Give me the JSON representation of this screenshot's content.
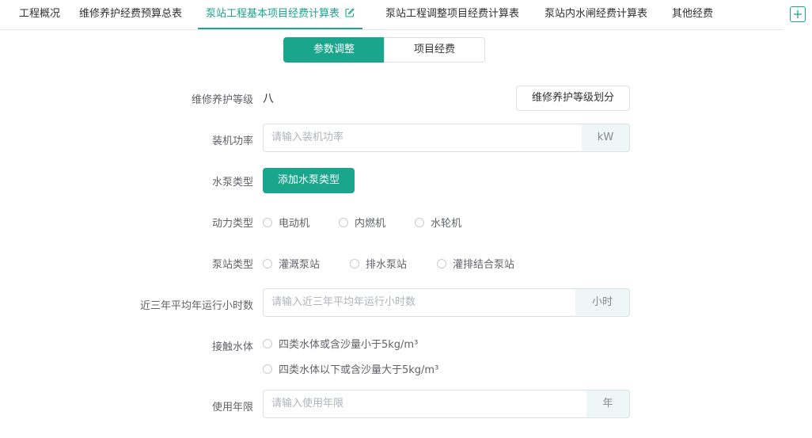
{
  "tabs": [
    {
      "label": "工程概况"
    },
    {
      "label": "维修养护经费预算总表"
    },
    {
      "label": "泵站工程基本项目经费计算表"
    },
    {
      "label": "泵站工程调整项目经费计算表"
    },
    {
      "label": "泵站内水闸经费计算表"
    },
    {
      "label": "其他经费"
    }
  ],
  "active_tab_index": 2,
  "segment": {
    "params_label": "参数调整",
    "funds_label": "项目经费"
  },
  "form": {
    "level": {
      "label": "维修养护等级",
      "value": "八",
      "button_label": "维修养护等级划分"
    },
    "power": {
      "label": "装机功率",
      "placeholder": "请输入装机功率",
      "unit": "kW"
    },
    "pump_type": {
      "label": "水泵类型",
      "button_label": "添加水泵类型"
    },
    "drive_type": {
      "label": "动力类型",
      "options": [
        "电动机",
        "内燃机",
        "水轮机"
      ]
    },
    "station_type": {
      "label": "泵站类型",
      "options": [
        "灌溉泵站",
        "排水泵站",
        "灌排结合泵站"
      ]
    },
    "hours": {
      "label": "近三年平均年运行小时数",
      "placeholder": "请输入近三年平均年运行小时数",
      "unit": "小时"
    },
    "water": {
      "label": "接触水体",
      "options": [
        "四类水体或含沙量小于5kg/m³",
        "四类水体以下或含沙量大于5kg/m³"
      ]
    },
    "years": {
      "label": "使用年限",
      "placeholder": "请输入使用年限",
      "unit": "年"
    }
  },
  "colors": {
    "accent": "#1aa58d",
    "border": "#dcdfe6",
    "append_bg": "#eef6f6"
  },
  "icons": {
    "edit": "edit-icon",
    "add": "plus-icon"
  }
}
